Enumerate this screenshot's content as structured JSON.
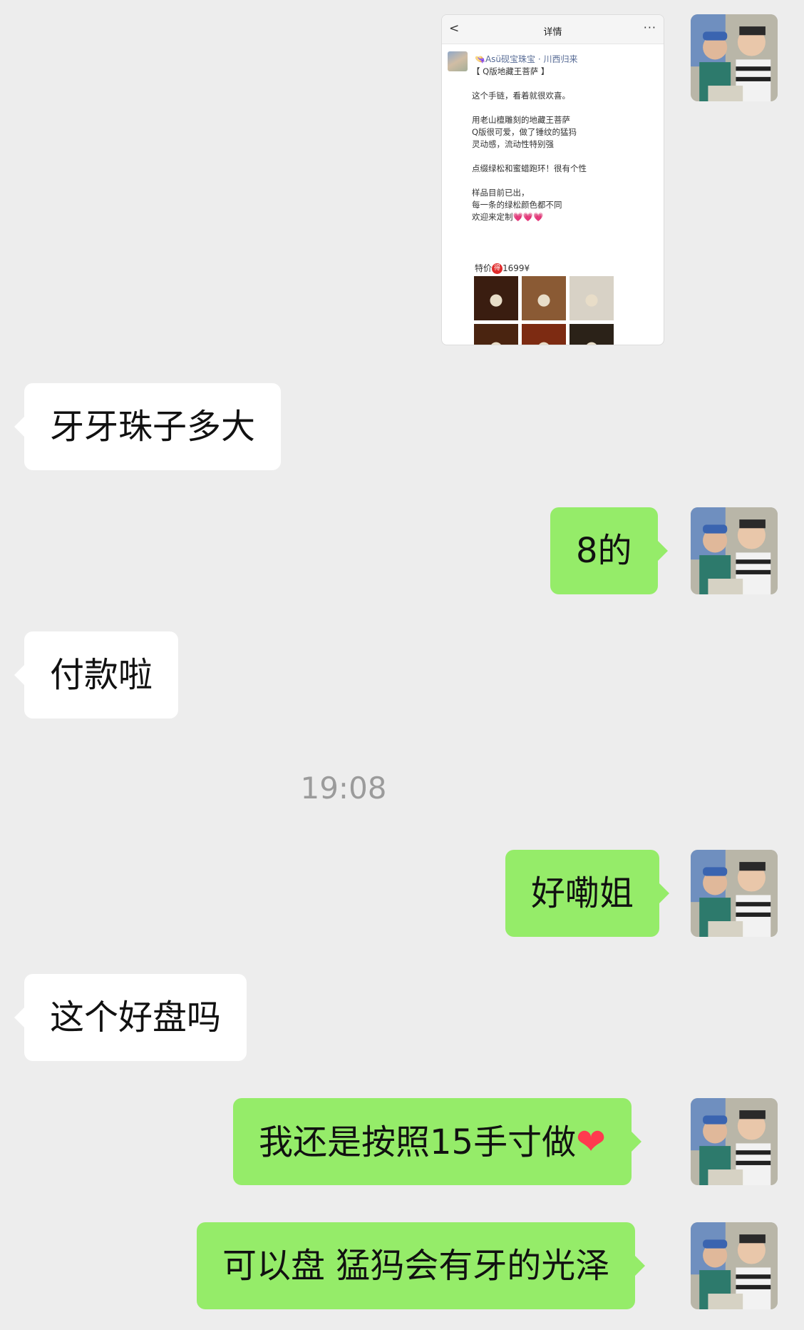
{
  "screenshot_card": {
    "nav_back": "<",
    "nav_title": "详情",
    "nav_more": "···",
    "author": "👒Asü砚宝珠宝 · 川西归来",
    "post_text": "【 Q版地藏王菩萨 】\n\n这个手链，看着就很欢喜。\n\n用老山檀雕刻的地藏王菩萨\nQ版很可爱，做了锤纹的猛犸\n灵动感，流动性特别强\n\n点缀绿松和蜜蜡跑环！很有个性\n\n样品目前已出，\n每一条的绿松颜色都不同\n欢迎来定制💗💗💗",
    "price_prefix": "特价",
    "price_badge": "得",
    "price_value": "1699¥",
    "photos": [
      {
        "name": "bracelet-photo-1",
        "color": "#3a1d10"
      },
      {
        "name": "bracelet-photo-2",
        "color": "#8a5a34"
      },
      {
        "name": "bracelet-photo-3",
        "color": "#d8d2c6"
      },
      {
        "name": "bracelet-photo-4",
        "color": "#4a2410"
      },
      {
        "name": "bracelet-photo-5",
        "color": "#7d2b12"
      },
      {
        "name": "bracelet-photo-6",
        "color": "#2b2218"
      }
    ]
  },
  "messages": {
    "m1": "牙牙珠子多大",
    "m2": "8的",
    "m3": "付款啦",
    "time": "19:08",
    "m4": "好嘞姐",
    "m5": "这个好盘吗",
    "m6": "我还是按照15手寸做",
    "m6_emoji": "❤",
    "m7": "可以盘 猛犸会有牙的光泽"
  },
  "colors": {
    "background": "#ededed",
    "incoming_bubble": "#ffffff",
    "outgoing_bubble": "#95ec69",
    "timestamp": "#9b9b9b"
  }
}
